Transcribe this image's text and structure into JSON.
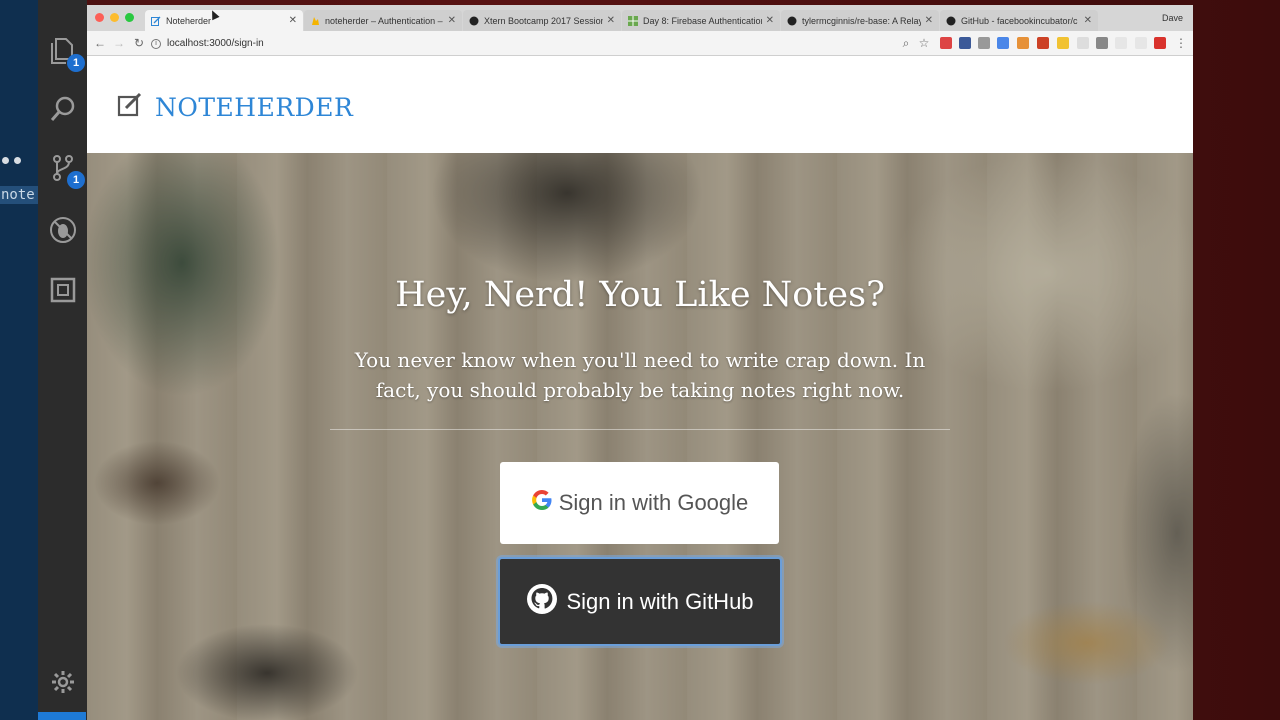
{
  "editor": {
    "explorer_badge": "1",
    "scm_badge": "1",
    "note_text": "note"
  },
  "browser": {
    "profile_name": "Dave",
    "url": "localhost:3000/sign-in",
    "tabs": [
      {
        "title": "Noteherder",
        "active": true
      },
      {
        "title": "noteherder – Authentication – "
      },
      {
        "title": "Xtern Bootcamp 2017 Session"
      },
      {
        "title": "Day 8: Firebase Authentication"
      },
      {
        "title": "tylermcginnis/re-base: A Relay"
      },
      {
        "title": "GitHub - facebookincubator/c"
      }
    ]
  },
  "app": {
    "logo_text": "NOTEHERDER",
    "hero_title": "Hey, Nerd! You Like Notes?",
    "hero_subtitle": "You never know when you'll need to write crap down. In fact, you should probably be taking notes right now.",
    "google_button": "Sign in with Google",
    "github_button": "Sign in with GitHub"
  },
  "colors": {
    "brand": "#2e86d6",
    "github_button_bg": "#333333",
    "vscode_badge": "#1e6fcf"
  }
}
